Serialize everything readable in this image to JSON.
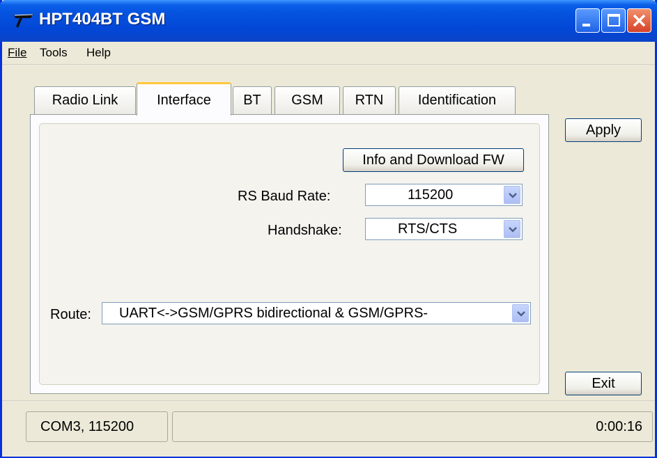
{
  "window": {
    "title": "HPT404BT GSM",
    "icon": "app-logo-icon",
    "controls": [
      "minimize-icon",
      "maximize-icon",
      "close-icon"
    ]
  },
  "menu": {
    "file": "File",
    "tools": "Tools",
    "help": "Help"
  },
  "tabs": [
    {
      "label": "Radio Link"
    },
    {
      "label": "Interface"
    },
    {
      "label": "BT"
    },
    {
      "label": "GSM"
    },
    {
      "label": "RTN"
    },
    {
      "label": "Identification"
    }
  ],
  "active_tab": "Interface",
  "interface": {
    "info_button": "Info and Download FW",
    "baud_label": "RS Baud Rate:",
    "baud_value": "115200",
    "handshake_label": "Handshake:",
    "handshake_value": "RTS/CTS",
    "route_label": "Route:",
    "route_value": "UART<->GSM/GPRS bidirectional & GSM/GPRS-"
  },
  "buttons": {
    "apply": "Apply",
    "exit": "Exit"
  },
  "status": {
    "port": "COM3, 115200",
    "middle": "",
    "time": "0:00:16"
  },
  "colors": {
    "titlebar": "#0a5fe8",
    "window_bg": "#ece9d8",
    "tab_accent": "#ffc83c",
    "close_button": "#d6432a"
  }
}
